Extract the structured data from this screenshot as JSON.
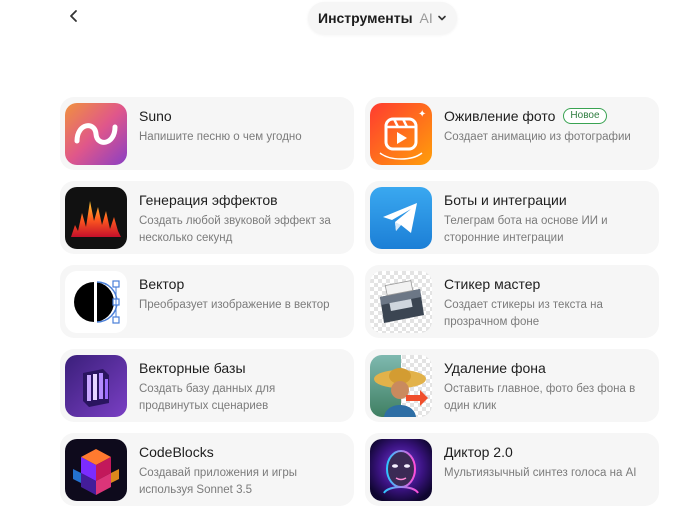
{
  "header": {
    "title": "Инструменты",
    "title_suffix": "AI",
    "back_icon": "chevron-left-icon",
    "dropdown_icon": "chevron-down-icon"
  },
  "tools": [
    {
      "name": "Suno",
      "description": "Напишите песню о чем угодно",
      "icon": "suno-wave-icon"
    },
    {
      "name": "Оживление фото",
      "badge": "Новое",
      "description": "Создает анимацию из фотографии",
      "icon": "reels-icon"
    },
    {
      "name": "Генерация эффектов",
      "description": "Создать любой звуковой эффект за несколько секунд",
      "icon": "sound-wave-icon"
    },
    {
      "name": "Боты и интеграции",
      "description": "Телеграм бота на основе ИИ и сторонние интеграции",
      "icon": "telegram-icon"
    },
    {
      "name": "Вектор",
      "description": "Преобразует изображение в вектор",
      "icon": "vector-circle-icon"
    },
    {
      "name": "Стикер мастер",
      "description": "Создает стикеры из текста на прозрачном фоне",
      "icon": "sticker-printer-icon"
    },
    {
      "name": "Векторные базы",
      "description": "Создать базу данных для продвинутых сценариев",
      "icon": "database-icon"
    },
    {
      "name": "Удаление фона",
      "description": "Оставить главное, фото без фона в один клик",
      "icon": "background-removal-icon"
    },
    {
      "name": "CodeBlocks",
      "description": "Создавай приложения и игры используя Sonnet 3.5",
      "icon": "code-blocks-icon"
    },
    {
      "name": "Диктор 2.0",
      "description": "Мультиязычный синтез голоса на AI",
      "icon": "voice-face-icon"
    }
  ]
}
